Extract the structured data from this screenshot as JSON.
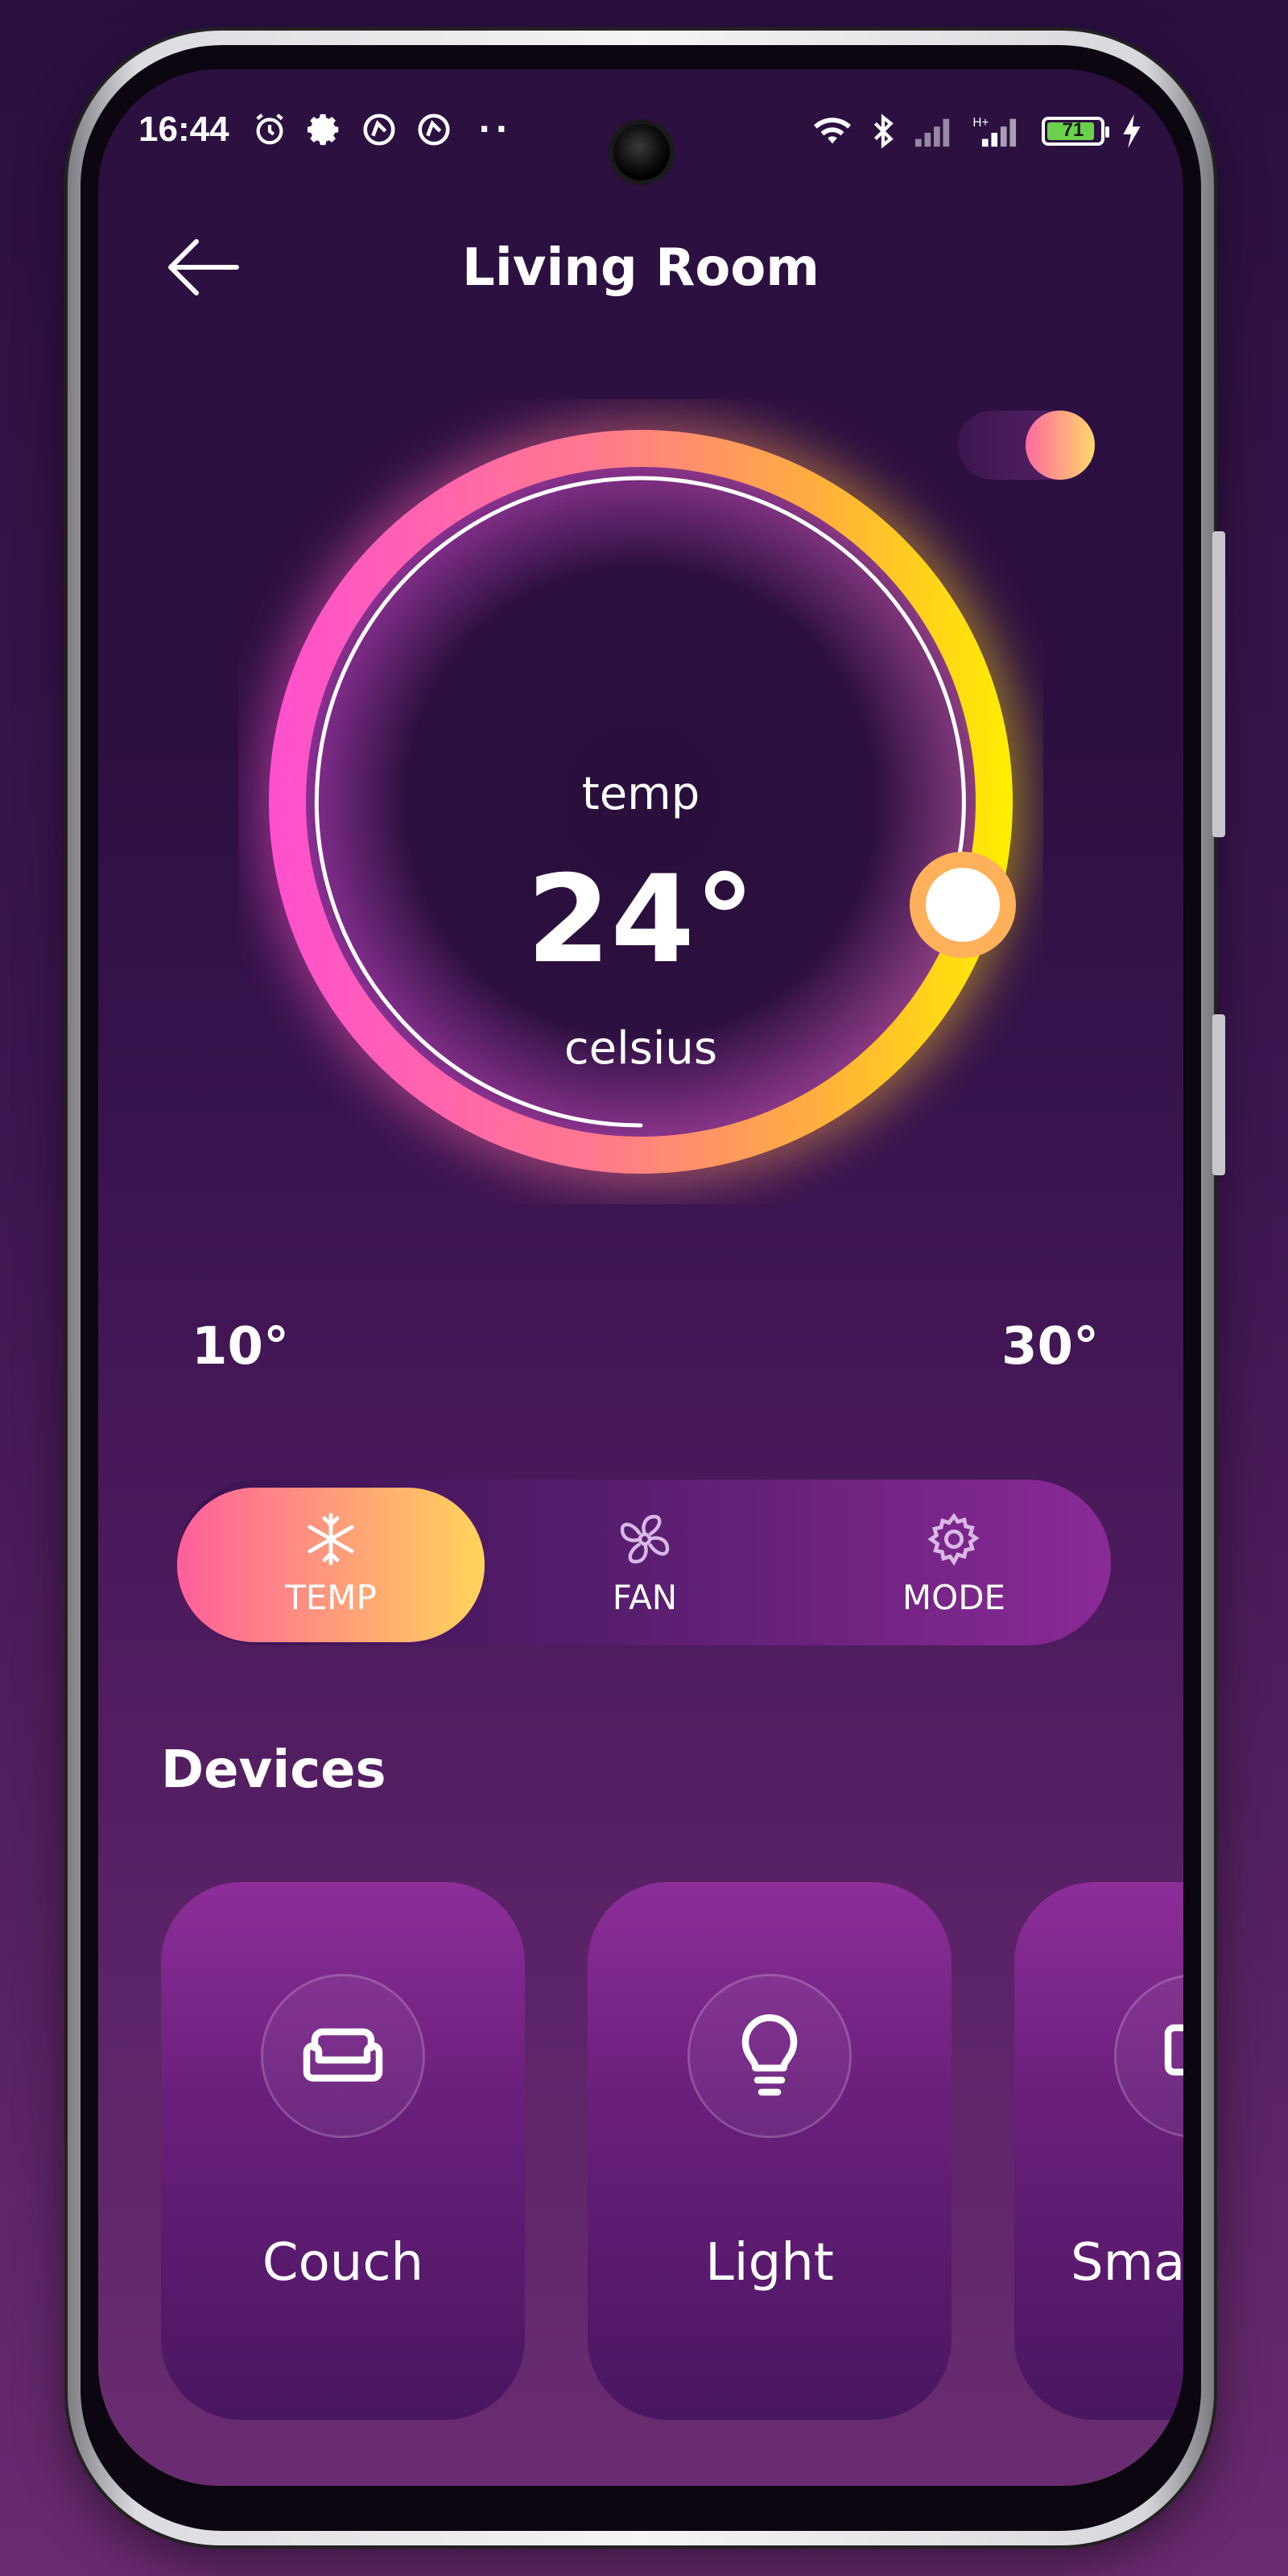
{
  "status_bar": {
    "time": "16:44",
    "left_icons": [
      "alarm-icon",
      "settings-icon",
      "app-icon",
      "app-icon",
      "more-dots-icon"
    ],
    "right_icons": [
      "wifi-icon",
      "bluetooth-icon",
      "signal-icon",
      "signal-icon",
      "battery-icon",
      "charging-icon"
    ],
    "battery_level": "71",
    "battery_color": "#6ad24a",
    "more_dots": "··"
  },
  "header": {
    "title": "Living Room",
    "back_icon": "arrow-left-icon"
  },
  "power_toggle": {
    "on": true
  },
  "thermostat": {
    "label": "temp",
    "value": "24°",
    "unit": "celsius",
    "min_label": "10°",
    "max_label": "30°",
    "min": 10,
    "max": 30,
    "current": 24,
    "gradient_colors": [
      "#ff4fcf",
      "#ff8a5a",
      "#ffe600"
    ]
  },
  "mode_tabs": [
    {
      "label": "TEMP",
      "icon": "snowflake-icon",
      "active": true
    },
    {
      "label": "FAN",
      "icon": "fan-icon",
      "active": false
    },
    {
      "label": "MODE",
      "icon": "gear-icon",
      "active": false
    }
  ],
  "devices": {
    "heading": "Devices",
    "items": [
      {
        "label": "Couch",
        "icon": "couch-icon"
      },
      {
        "label": "Light",
        "icon": "lightbulb-icon"
      },
      {
        "label": "Sma",
        "icon": "device-icon"
      }
    ]
  }
}
